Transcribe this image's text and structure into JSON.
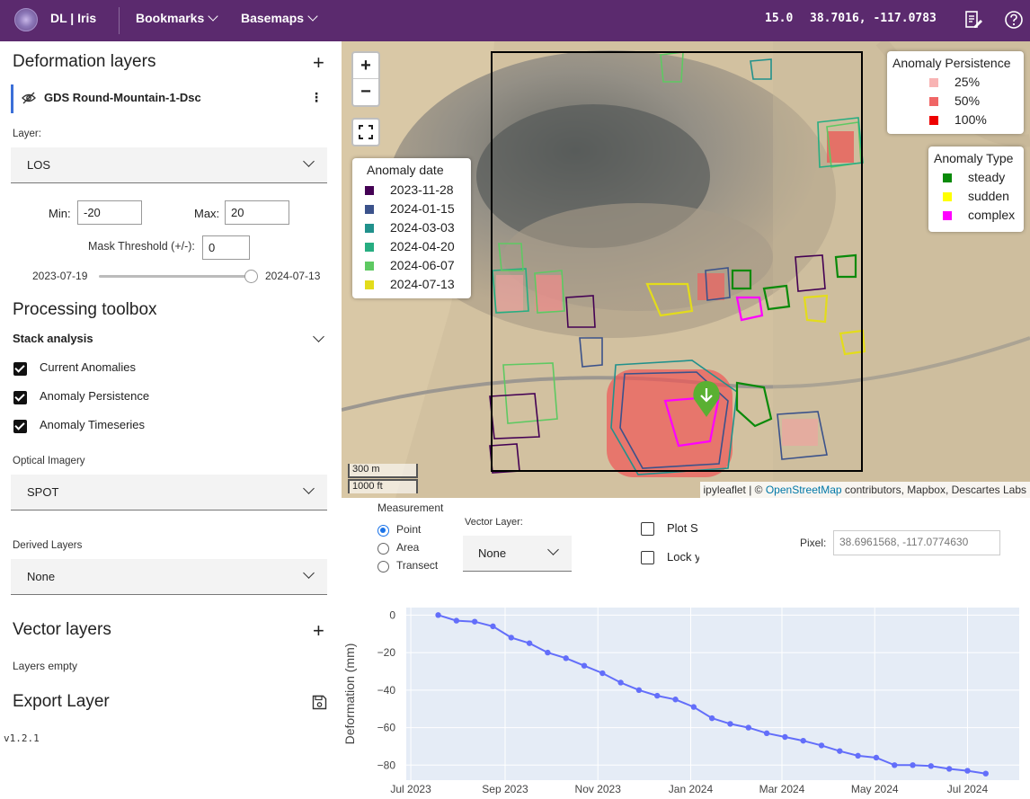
{
  "header": {
    "brand": "DL | Iris",
    "menus": [
      "Bookmarks",
      "Basemaps"
    ],
    "zoom": "15.0",
    "coords": "38.7016, -117.0783"
  },
  "left": {
    "deformation_title": "Deformation layers",
    "layer_name": "GDS Round-Mountain-1-Dsc",
    "layer_label": "Layer:",
    "layer_value": "LOS",
    "min_label": "Min:",
    "min_value": "-20",
    "max_label": "Max:",
    "max_value": "20",
    "mask_label": "Mask Threshold (+/-):",
    "mask_value": "0",
    "date_start": "2023-07-19",
    "date_end": "2024-07-13",
    "date_slider_fraction": 1.0,
    "processing_title": "Processing toolbox",
    "stack_label": "Stack analysis",
    "checks": [
      "Current Anomalies",
      "Anomaly Persistence",
      "Anomaly Timeseries"
    ],
    "optical_label": "Optical Imagery",
    "optical_value": "SPOT",
    "derived_label": "Derived Layers",
    "derived_value": "None",
    "vector_title": "Vector layers",
    "layers_empty": "Layers empty",
    "export_title": "Export Layer",
    "version": "v1.2.1"
  },
  "map": {
    "zoom_in": "+",
    "zoom_out": "−",
    "anomaly_date": {
      "title": "Anomaly date",
      "items": [
        {
          "label": "2023-11-28",
          "color": "#440154"
        },
        {
          "label": "2024-01-15",
          "color": "#3b528b"
        },
        {
          "label": "2024-03-03",
          "color": "#21918c"
        },
        {
          "label": "2024-04-20",
          "color": "#27ad81"
        },
        {
          "label": "2024-06-07",
          "color": "#5ec962"
        },
        {
          "label": "2024-07-13",
          "color": "#e3dc1b"
        }
      ]
    },
    "persistence": {
      "title": "Anomaly Persistence",
      "items": [
        {
          "label": "25%",
          "color": "#f8b4b4"
        },
        {
          "label": "50%",
          "color": "#f06666"
        },
        {
          "label": "100%",
          "color": "#ee0000"
        }
      ]
    },
    "anomaly_type": {
      "title": "Anomaly Type",
      "items": [
        {
          "label": "steady",
          "color": "#0a8a0a"
        },
        {
          "label": "sudden",
          "color": "#ffff00"
        },
        {
          "label": "complex",
          "color": "#ff00ff"
        }
      ]
    },
    "scale_m": "300 m",
    "scale_ft": "1000 ft",
    "attribution_pre": "ipyleaflet | © ",
    "attribution_link": "OpenStreetMap",
    "attribution_post": " contributors, Mapbox, Descartes Labs"
  },
  "measure": {
    "title": "Measurement",
    "options": [
      "Point",
      "Area",
      "Transect"
    ],
    "selected": "Point",
    "vector_label": "Vector Layer:",
    "vector_value": "None",
    "plot_label": "Plot S",
    "lock_label": "Lock y",
    "pixel_label": "Pixel:",
    "pixel_value": "38.6961568, -117.0774630"
  },
  "chart_data": {
    "type": "line",
    "xlabel": "",
    "ylabel": "Deformation (mm)",
    "x_ticks": [
      "Jul 2023",
      "Sep 2023",
      "Nov 2023",
      "Jan 2024",
      "Mar 2024",
      "May 2024",
      "Jul 2024"
    ],
    "y_ticks": [
      "0",
      "−20",
      "−40",
      "−60",
      "−80"
    ],
    "xlim": [
      "2023-06-28",
      "2024-08-04"
    ],
    "ylim": [
      -88,
      4
    ],
    "grid": true,
    "color": "#636efa",
    "x": [
      "2023-07-19",
      "2023-07-31",
      "2023-08-12",
      "2023-08-24",
      "2023-09-05",
      "2023-09-17",
      "2023-09-29",
      "2023-10-11",
      "2023-10-23",
      "2023-11-04",
      "2023-11-16",
      "2023-11-28",
      "2023-12-10",
      "2023-12-22",
      "2024-01-03",
      "2024-01-15",
      "2024-01-27",
      "2024-02-08",
      "2024-02-20",
      "2024-03-03",
      "2024-03-15",
      "2024-03-27",
      "2024-04-08",
      "2024-04-20",
      "2024-05-02",
      "2024-05-14",
      "2024-05-26",
      "2024-06-07",
      "2024-06-19",
      "2024-07-01",
      "2024-07-13"
    ],
    "y": [
      0,
      -3,
      -3.5,
      -6,
      -12,
      -15,
      -20,
      -23,
      -27,
      -31,
      -36,
      -40,
      -43,
      -45,
      -49,
      -55,
      -58,
      -60,
      -63,
      -65,
      -67,
      -69.5,
      -72.5,
      -75,
      -76,
      -80,
      -80,
      -80.5,
      -82,
      -83,
      -84.5
    ]
  }
}
